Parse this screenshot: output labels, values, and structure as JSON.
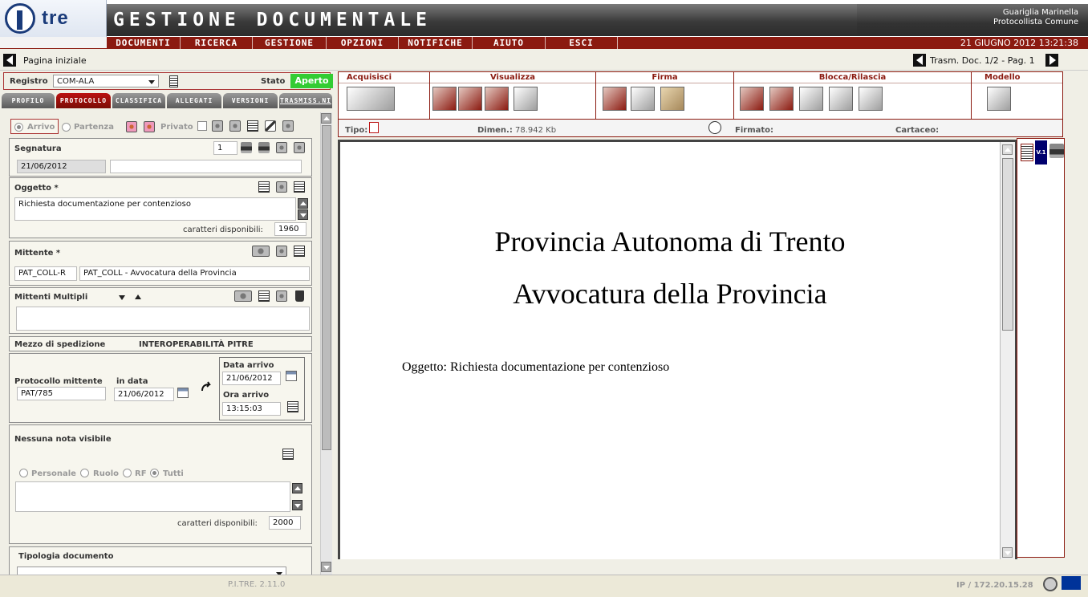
{
  "header": {
    "logo_text": "tre",
    "app_title": "GESTIONE DOCUMENTALE",
    "user_name": "Guariglia Marinella",
    "user_role": "Protocollista Comune"
  },
  "menu": {
    "items": [
      "DOCUMENTI",
      "RICERCA",
      "GESTIONE",
      "OPZIONI",
      "NOTIFICHE",
      "AIUTO",
      "ESCI"
    ],
    "datetime": "21 GIUGNO 2012 13:21:38"
  },
  "nav": {
    "home_label": "Pagina iniziale",
    "trasm_label": "Trasm. Doc. 1/2 - Pag. 1"
  },
  "registro": {
    "label": "Registro",
    "value": "COM-ALA",
    "stato_label": "Stato",
    "stato_value": "Aperto"
  },
  "tabs": [
    "PROFILO",
    "PROTOCOLLO",
    "CLASSIFICA",
    "ALLEGATI",
    "VERSIONI",
    "TRASMISS.NI"
  ],
  "proto": {
    "arrivo": "Arrivo",
    "partenza": "Partenza",
    "privato": "Privato"
  },
  "segnatura": {
    "label": "Segnatura",
    "count": "1",
    "date": "21/06/2012"
  },
  "oggetto": {
    "label": "Oggetto *",
    "value": "Richiesta documentazione per contenzioso",
    "chars_label": "caratteri disponibili:",
    "chars": "1960"
  },
  "mittente": {
    "label": "Mittente *",
    "code": "PAT_COLL-R",
    "desc": "PAT_COLL - Avvocatura della Provincia"
  },
  "mittenti_multipli": {
    "label": "Mittenti Multipli"
  },
  "mezzo": {
    "label": "Mezzo di spedizione",
    "value": "INTEROPERABILITÀ PITRE"
  },
  "protocollo_mittente": {
    "label": "Protocollo mittente",
    "value": "PAT/785",
    "in_data_label": "in data",
    "in_data": "21/06/2012",
    "data_arrivo_label": "Data arrivo",
    "data_arrivo": "21/06/2012",
    "ora_arrivo_label": "Ora arrivo",
    "ora_arrivo": "13:15:03"
  },
  "note": {
    "label": "Nessuna nota visibile",
    "radios": [
      "Personale",
      "Ruolo",
      "RF",
      "Tutti"
    ],
    "chars_label": "caratteri disponibili:",
    "chars": "2000"
  },
  "tipologia": {
    "label": "Tipologia documento"
  },
  "toolbar": {
    "groups": [
      "Acquisisci",
      "Visualizza",
      "Firma",
      "Blocca/Rilascia",
      "Modello"
    ],
    "tipo_label": "Tipo:",
    "dimen_label": "Dimen.:",
    "dimen_value": "78.942 Kb",
    "firmato_label": "Firmato:",
    "cartaceo_label": "Cartaceo:"
  },
  "document": {
    "line1": "Provincia Autonoma di Trento",
    "line2": "Avvocatura della Provincia",
    "oggetto": "Oggetto: Richiesta documentazione per contenzioso"
  },
  "versions": {
    "badge": "V.1"
  },
  "footer": {
    "version": "P.I.TRE. 2.11.0",
    "ip": "IP / 172.20.15.28"
  },
  "colors": {
    "accent": "#8b1a10",
    "stato_green": "#33cc33"
  }
}
